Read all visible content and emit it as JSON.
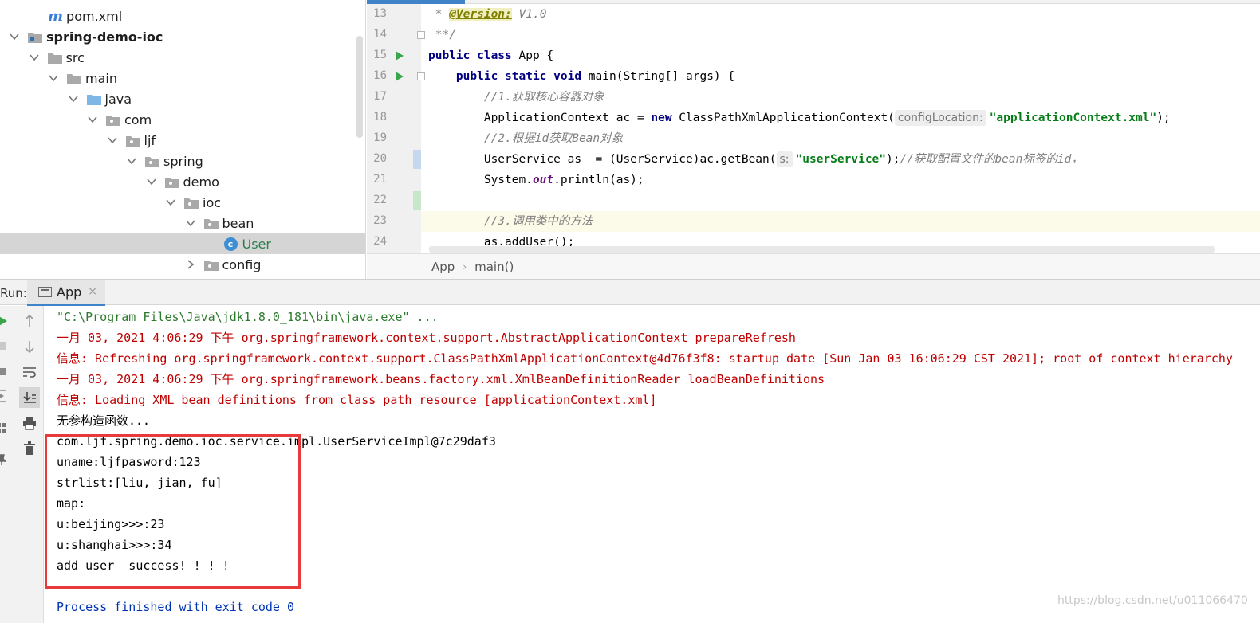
{
  "tree": {
    "items": [
      {
        "label": "pom.xml",
        "depth": 2,
        "type": "maven",
        "expanded": null
      },
      {
        "label": "spring-demo-ioc",
        "depth": 0,
        "type": "module",
        "expanded": true
      },
      {
        "label": "src",
        "depth": 1,
        "type": "folder",
        "expanded": true
      },
      {
        "label": "main",
        "depth": 2,
        "type": "folder",
        "expanded": true
      },
      {
        "label": "java",
        "depth": 3,
        "type": "source-folder",
        "expanded": true
      },
      {
        "label": "com",
        "depth": 4,
        "type": "package",
        "expanded": true
      },
      {
        "label": "ljf",
        "depth": 5,
        "type": "package",
        "expanded": true
      },
      {
        "label": "spring",
        "depth": 6,
        "type": "package",
        "expanded": true
      },
      {
        "label": "demo",
        "depth": 7,
        "type": "package",
        "expanded": true
      },
      {
        "label": "ioc",
        "depth": 8,
        "type": "package",
        "expanded": true
      },
      {
        "label": "bean",
        "depth": 9,
        "type": "package",
        "expanded": true
      },
      {
        "label": "User",
        "depth": 11,
        "type": "class",
        "expanded": null,
        "selected": true
      },
      {
        "label": "config",
        "depth": 9,
        "type": "package",
        "expanded": false
      }
    ]
  },
  "editor": {
    "line_numbers": [
      "13",
      "14",
      "15",
      "16",
      "17",
      "18",
      "19",
      "20",
      "21",
      "22",
      "23",
      "24"
    ],
    "caret_line": "23",
    "lines": [
      {
        "indent": 0,
        "parts": [
          {
            "t": " * ",
            "c": "cm"
          },
          {
            "t": "@Version:",
            "c": "doc-tag"
          },
          {
            "t": " V1.0",
            "c": "cm"
          }
        ]
      },
      {
        "indent": 0,
        "parts": [
          {
            "t": " **/",
            "c": "cm"
          }
        ]
      },
      {
        "indent": 0,
        "parts": [
          {
            "t": "public class ",
            "c": "kw"
          },
          {
            "t": "App {",
            "c": ""
          }
        ]
      },
      {
        "indent": 4,
        "parts": [
          {
            "t": "public static void ",
            "c": "kw"
          },
          {
            "t": "main(String[] args) {",
            "c": ""
          }
        ]
      },
      {
        "indent": 8,
        "parts": [
          {
            "t": "//1.获取核心容器对象",
            "c": "cm"
          }
        ]
      },
      {
        "indent": 8,
        "parts": [
          {
            "t": "ApplicationContext ac = ",
            "c": ""
          },
          {
            "t": "new ",
            "c": "kw"
          },
          {
            "t": "ClassPathXmlApplicationContext(",
            "c": ""
          },
          {
            "t": "configLocation:",
            "c": "hint"
          },
          {
            "t": "\"applicationContext.xml\"",
            "c": "str"
          },
          {
            "t": ");",
            "c": ""
          }
        ]
      },
      {
        "indent": 8,
        "parts": [
          {
            "t": "//2.根据id获取Bean对象",
            "c": "cm"
          }
        ]
      },
      {
        "indent": 8,
        "parts": [
          {
            "t": "UserService as  = (UserService)ac.getBean(",
            "c": ""
          },
          {
            "t": "s:",
            "c": "hint"
          },
          {
            "t": "\"userService\"",
            "c": "str"
          },
          {
            "t": ");",
            "c": ""
          },
          {
            "t": "//获取配置文件的bean标签的id，",
            "c": "cm"
          }
        ]
      },
      {
        "indent": 8,
        "parts": [
          {
            "t": "System.",
            "c": ""
          },
          {
            "t": "out",
            "c": "field"
          },
          {
            "t": ".println(as);",
            "c": ""
          }
        ]
      },
      {
        "indent": 0,
        "parts": []
      },
      {
        "indent": 8,
        "parts": [
          {
            "t": "//3.调用类中的方法",
            "c": "cm"
          }
        ]
      },
      {
        "indent": 8,
        "parts": [
          {
            "t": "as.addUser();",
            "c": ""
          }
        ]
      }
    ],
    "breadcrumb": [
      "App",
      "main()"
    ]
  },
  "run": {
    "label": "Run:",
    "tab_label": "App",
    "tab_close": "×",
    "output": [
      {
        "text": "\"C:\\Program Files\\Java\\jdk1.8.0_181\\bin\\java.exe\" ...",
        "style": "c-cmd"
      },
      {
        "text": "一月 03, 2021 4:06:29 下午 org.springframework.context.support.AbstractApplicationContext prepareRefresh",
        "style": "c-red"
      },
      {
        "text": "信息: Refreshing org.springframework.context.support.ClassPathXmlApplicationContext@4d76f3f8: startup date [Sun Jan 03 16:06:29 CST 2021]; root of context hierarchy",
        "style": "c-red"
      },
      {
        "text": "一月 03, 2021 4:06:29 下午 org.springframework.beans.factory.xml.XmlBeanDefinitionReader loadBeanDefinitions",
        "style": "c-red"
      },
      {
        "text": "信息: Loading XML bean definitions from class path resource [applicationContext.xml]",
        "style": "c-red"
      },
      {
        "text": "无参构造函数...",
        "style": "c-black"
      },
      {
        "text": "com.ljf.spring.demo.ioc.service.impl.UserServiceImpl@7c29daf3",
        "style": "c-black"
      },
      {
        "text": "uname:ljfpasword:123",
        "style": "c-black"
      },
      {
        "text": "strlist:[liu, jian, fu]",
        "style": "c-black"
      },
      {
        "text": "map:",
        "style": "c-black"
      },
      {
        "text": "u:beijing>>>:23",
        "style": "c-black"
      },
      {
        "text": "u:shanghai>>>:34",
        "style": "c-black"
      },
      {
        "text": "add user  success! ! ! !",
        "style": "c-black"
      },
      {
        "text": "",
        "style": "c-black"
      },
      {
        "text": "Process finished with exit code 0",
        "style": "c-blue"
      }
    ]
  },
  "watermark": "https://blog.csdn.net/u011066470",
  "colors": {
    "accent": "#4083c9",
    "run_green": "#3aa54a",
    "highlight_red": "#e8393b",
    "log_red": "#c00000"
  }
}
